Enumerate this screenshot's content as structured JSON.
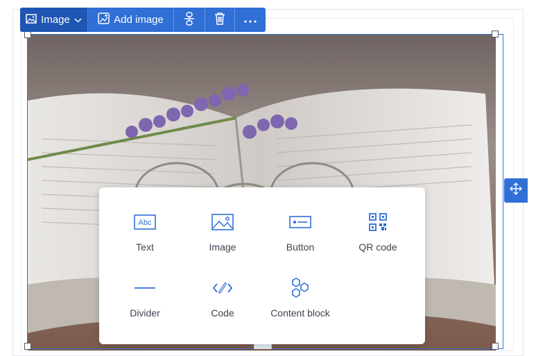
{
  "toolbar": {
    "image_label": "Image",
    "add_image_label": "Add image"
  },
  "insert_menu": {
    "items": [
      {
        "label": "Text",
        "icon": "text-abc-icon"
      },
      {
        "label": "Image",
        "icon": "image-icon"
      },
      {
        "label": "Button",
        "icon": "button-icon"
      },
      {
        "label": "QR code",
        "icon": "qr-code-icon"
      },
      {
        "label": "Divider",
        "icon": "divider-icon"
      },
      {
        "label": "Code",
        "icon": "code-icon"
      },
      {
        "label": "Content block",
        "icon": "content-block-icon"
      }
    ]
  },
  "colors": {
    "accent": "#2f6fd6",
    "accent_dark": "#1f55b3",
    "menu_text": "#3c4350"
  }
}
